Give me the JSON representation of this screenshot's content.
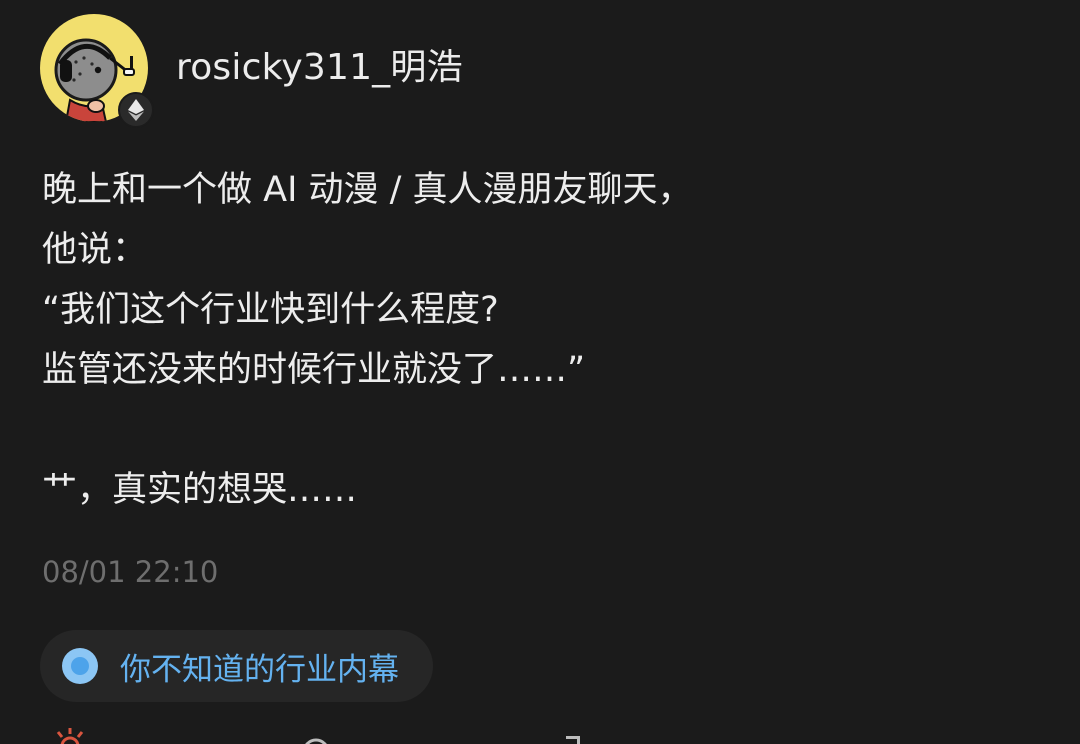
{
  "author": {
    "username": "rosicky311_明浩",
    "avatar_icon": "headset-character-avatar",
    "badge_icon": "ethereum-icon"
  },
  "post": {
    "lines": [
      "晚上和一个做 AI 动漫 / 真人漫朋友聊天，",
      "他说：",
      "“我们这个行业快到什么程度?",
      "监管还没来的时候行业就没了……”",
      "",
      "艹，真实的想哭……"
    ],
    "timestamp": "08/01 22:10"
  },
  "topic": {
    "label": "你不知道的行业内幕",
    "icon": "topic-dot-icon"
  },
  "colors": {
    "background": "#1b1b1b",
    "text": "#ededed",
    "muted": "#6e6e6e",
    "topic_accent": "#64b2f0",
    "avatar_bg": "#f2df6e"
  },
  "action_bar": {
    "icons": [
      "like-icon",
      "comment-icon",
      "share-icon"
    ]
  }
}
